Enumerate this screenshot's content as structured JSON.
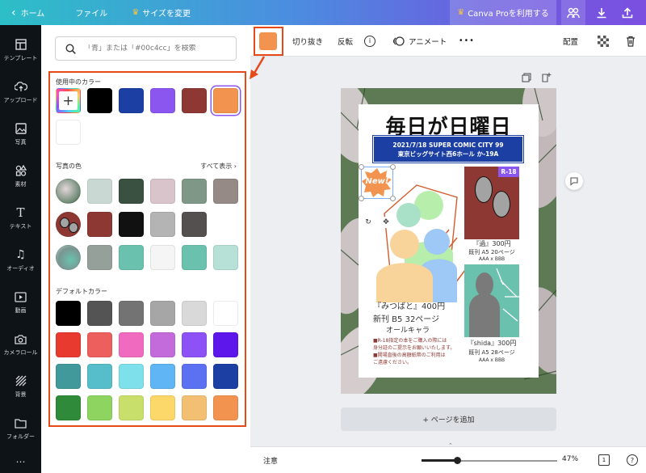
{
  "topbar": {
    "home": "ホーム",
    "file": "ファイル",
    "resize": "サイズを変更",
    "pro": "Canva Proを利用する"
  },
  "nav": {
    "items": [
      {
        "label": "テンプレート",
        "icon": "template-icon"
      },
      {
        "label": "アップロード",
        "icon": "upload-icon"
      },
      {
        "label": "写真",
        "icon": "photo-icon"
      },
      {
        "label": "素材",
        "icon": "elements-icon"
      },
      {
        "label": "テキスト",
        "icon": "text-icon"
      },
      {
        "label": "オーディオ",
        "icon": "music-icon"
      },
      {
        "label": "動画",
        "icon": "video-icon"
      },
      {
        "label": "カメラロール",
        "icon": "camera-icon"
      },
      {
        "label": "背景",
        "icon": "background-icon"
      },
      {
        "label": "フォルダー",
        "icon": "folder-icon"
      }
    ],
    "more": "…"
  },
  "panel": {
    "search_placeholder": "「青」または「#00c4cc」を検索",
    "in_use_title": "使用中のカラー",
    "in_use_colors": [
      "#000000",
      "#1b3fa3",
      "#8b55f0",
      "#8d3833",
      "#f2944f"
    ],
    "photo_title": "写真の色",
    "see_all": "すべて表示",
    "photo_rows": [
      [
        "#c9d8d3",
        "#3a5040",
        "#d9c4cc",
        "#7f9786",
        "#958a85"
      ],
      [
        "#8d3833",
        "#111111",
        "#b4b4b4",
        "#545050"
      ],
      [
        "#95a09a",
        "#6ac2ae",
        "#f5f5f5",
        "#6ac2ae",
        "#b7e0d6"
      ]
    ],
    "default_title": "デフォルトカラー",
    "default_colors": [
      "#000000",
      "#545454",
      "#737373",
      "#a6a6a6",
      "#d9d9d9",
      "#ffffff",
      "#e93a30",
      "#ed5f5c",
      "#f06bbf",
      "#c46bdb",
      "#8c52f5",
      "#5e17eb",
      "#41999b",
      "#56bdca",
      "#7ee0ea",
      "#60b5f4",
      "#5c71f2",
      "#1c3fa4",
      "#2f8a3a",
      "#8ed460",
      "#c8e06b",
      "#fcd86a",
      "#f3c073",
      "#f2944f"
    ]
  },
  "toolbar": {
    "crop": "切り抜き",
    "flip": "反転",
    "animate": "アニメート",
    "more": "•••",
    "position": "配置",
    "current_color": "#f2944f"
  },
  "poster": {
    "title": "毎日が日曜日",
    "banner_line1": "2021/7/18 SUPER COMIC CITY 99",
    "banner_line2": "東京ビッグサイト西6ホール か-19A",
    "new_badge": "New!",
    "r18": "R-18",
    "main_book": "『みつばと』400円",
    "main_spec": "新刊 B5 32ページ",
    "main_tag": "オールキャラ",
    "notice1": "■R-18指定の本をご購入の際には",
    "notice2": "身分証のご提示をお願いいたします。",
    "notice3": "■開場直後の高額紙幣のご利用は",
    "notice4": "ご遠慮ください。",
    "book1_title": "『過』300円",
    "book1_spec": "既刊 A5 20ページ",
    "book1_pair": "AAA x BBB",
    "book2_title": "『shida』300円",
    "book2_spec": "既刊 A5 28ページ",
    "book2_pair": "AAA x BBB"
  },
  "canvas": {
    "add_page": "+ ページを追加"
  },
  "bottombar": {
    "notes": "注意",
    "zoom": "47%",
    "page_number": "1",
    "help": "?"
  },
  "accent": "#e64a19"
}
